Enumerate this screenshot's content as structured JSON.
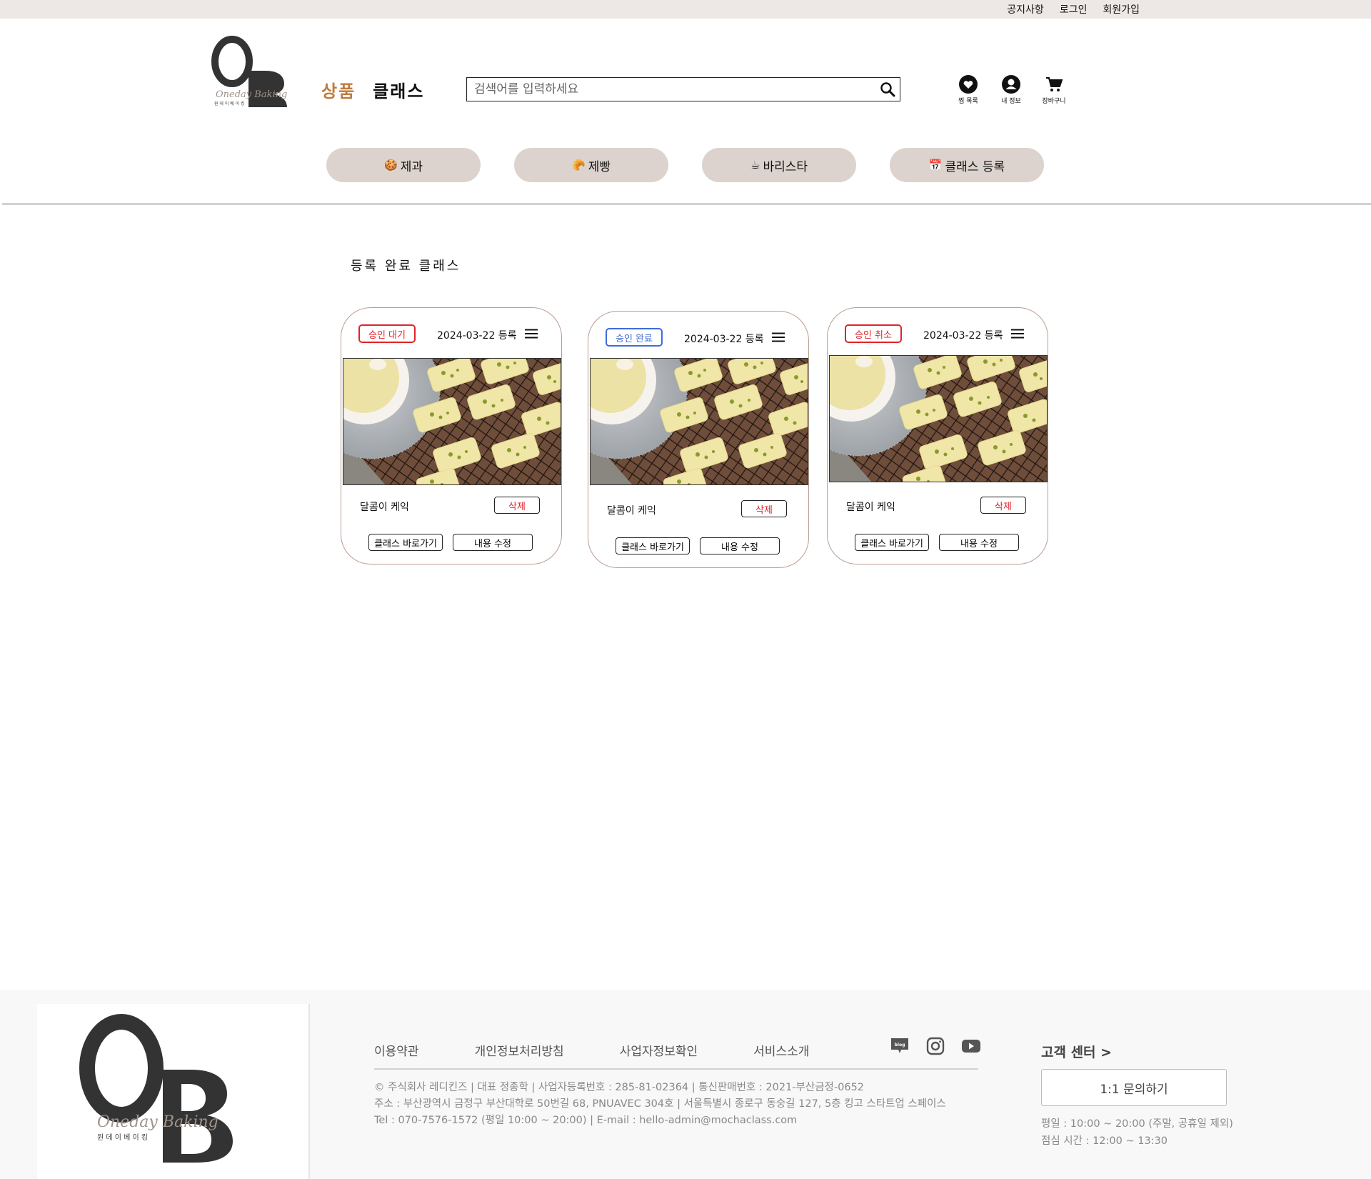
{
  "topbar": {
    "links": [
      "공지사항",
      "로그인",
      "회원가입"
    ]
  },
  "logo": {
    "letters": "OB",
    "script": "Oneday Baking",
    "korean": "원 데 이  베 이 킹"
  },
  "nav": {
    "items": [
      "상품",
      "클래스"
    ],
    "active_color": "#c07a3c"
  },
  "search": {
    "placeholder": "검색어를 입력하세요",
    "icon": "search-icon"
  },
  "user_icons": [
    {
      "label": "찜 목록",
      "icon": "heart-icon"
    },
    {
      "label": "내 정보",
      "icon": "user-icon"
    },
    {
      "label": "장바구니",
      "icon": "cart-icon"
    }
  ],
  "categories": [
    {
      "emoji": "🍪",
      "label": "제과"
    },
    {
      "emoji": "🥐",
      "label": "제빵"
    },
    {
      "emoji": "☕",
      "label": "바리스타"
    },
    {
      "emoji": "📅",
      "label": "클래스 등록"
    }
  ],
  "section_title": "등록 완료 클래스",
  "cards": [
    {
      "status": "승인 대기",
      "status_color": "red",
      "date": "2024-03-22 등록",
      "name": "달콤이 케익",
      "delete": "삭제",
      "goto": "클래스 바로가기",
      "edit": "내용 수정"
    },
    {
      "status": "승인 완료",
      "status_color": "blue",
      "date": "2024-03-22 등록",
      "name": "달콤이 케익",
      "delete": "삭제",
      "goto": "클래스 바로가기",
      "edit": "내용 수정"
    },
    {
      "status": "승인 취소",
      "status_color": "red",
      "date": "2024-03-22 등록",
      "name": "달콤이 케익",
      "delete": "삭제",
      "goto": "클래스 바로가기",
      "edit": "내용 수정"
    }
  ],
  "footer": {
    "links": [
      "이용약관",
      "개인정보처리방침",
      "사업자정보확인",
      "서비스소개"
    ],
    "social": [
      "blog-icon",
      "instagram-icon",
      "youtube-icon"
    ],
    "info": [
      "© 주식회사 레디킨즈 | 대표 정종학 | 사업자등록번호 : 285-81-02364 | 통신판매번호 : 2021-부산금정-0652",
      "주소 : 부산광역시 금정구 부산대학로 50번길 68, PNUAVEC 304호 | 서울특별시 종로구 동숭길 127, 5층 킹고 스타트업 스페이스",
      "Tel : 070-7576-1572 (평일 10:00 ~ 20:00) | E-mail : hello-admin@mochaclass.com"
    ],
    "cs_title": "고객 센터 >",
    "cs_button": "1:1 문의하기",
    "cs_hours": [
      "평일 : 10:00 ~ 20:00 (주말, 공휴일 제외)",
      "점심 시간 : 12:00 ~ 13:30"
    ]
  }
}
